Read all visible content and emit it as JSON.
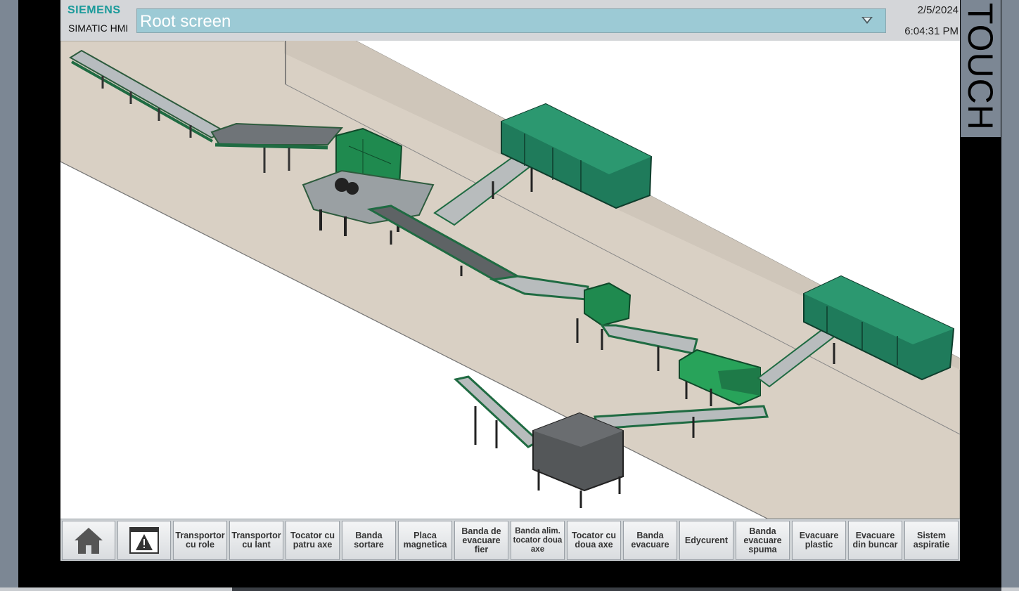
{
  "header": {
    "brand": "SIEMENS",
    "product": "SIMATIC HMI",
    "screen_select": "Root screen",
    "date": "2/5/2024",
    "time": "6:04:31 PM",
    "side_label": "TOUCH"
  },
  "nav": {
    "home_icon": "home-icon",
    "alarm_icon": "alarm-window-icon",
    "buttons": [
      "Transportor cu role",
      "Transportor cu lant",
      "Tocator cu patru axe",
      "Banda sortare",
      "Placa magnetica",
      "Banda de evacuare fier",
      "Banda alim. tocator doua axe",
      "Tocator cu doua axe",
      "Banda evacuare",
      "Edycurent",
      "Banda evacuare spuma",
      "Evacuare plastic",
      "Evacuare din buncar",
      "Sistem aspiratie"
    ]
  },
  "colors": {
    "brand": "#1a9a9a",
    "select_bg": "#9ccad5",
    "floor": "#d8cfc3",
    "machine_green": "#1f8a5a",
    "container_green": "#1e7a5c"
  }
}
